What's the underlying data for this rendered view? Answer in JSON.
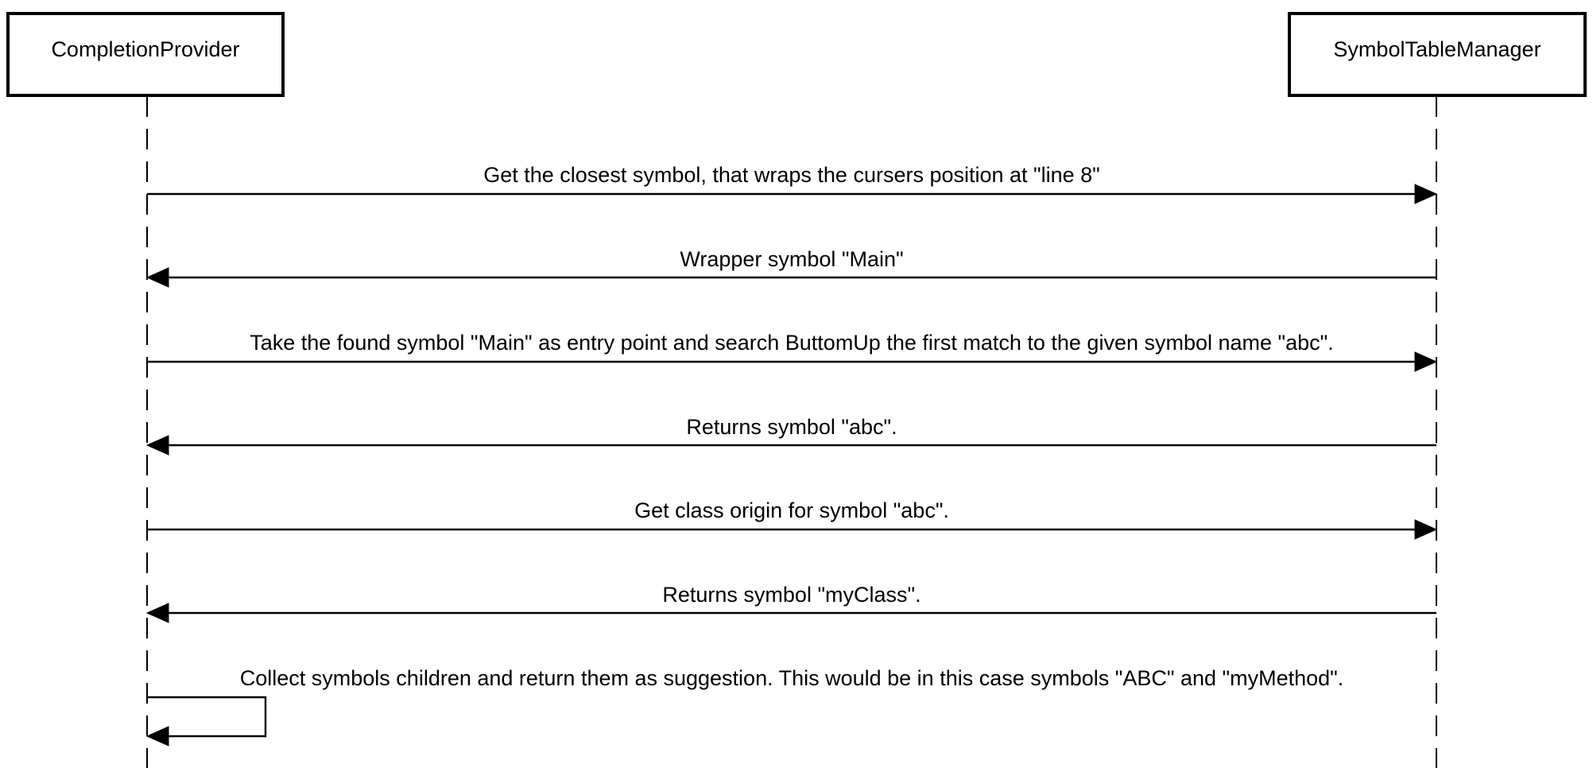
{
  "participants": [
    {
      "id": "completion_provider",
      "label": "CompletionProvider"
    },
    {
      "id": "symbol_table_manager",
      "label": "SymbolTableManager"
    }
  ],
  "messages": [
    {
      "from": "completion_provider",
      "to": "symbol_table_manager",
      "label": "Get the closest symbol, that wraps the cursers position at \"line 8\""
    },
    {
      "from": "symbol_table_manager",
      "to": "completion_provider",
      "label": "Wrapper symbol \"Main\""
    },
    {
      "from": "completion_provider",
      "to": "symbol_table_manager",
      "label": "Take the found symbol \"Main\" as entry point and search ButtomUp the first match to the given symbol name \"abc\"."
    },
    {
      "from": "symbol_table_manager",
      "to": "completion_provider",
      "label": "Returns symbol \"abc\"."
    },
    {
      "from": "completion_provider",
      "to": "symbol_table_manager",
      "label": "Get class origin for symbol \"abc\"."
    },
    {
      "from": "symbol_table_manager",
      "to": "completion_provider",
      "label": "Returns symbol \"myClass\"."
    },
    {
      "from": "completion_provider",
      "to": "completion_provider",
      "label": "Collect symbols children and return them as suggestion. This would be in this case symbols \"ABC\" and \"myMethod\"."
    }
  ]
}
